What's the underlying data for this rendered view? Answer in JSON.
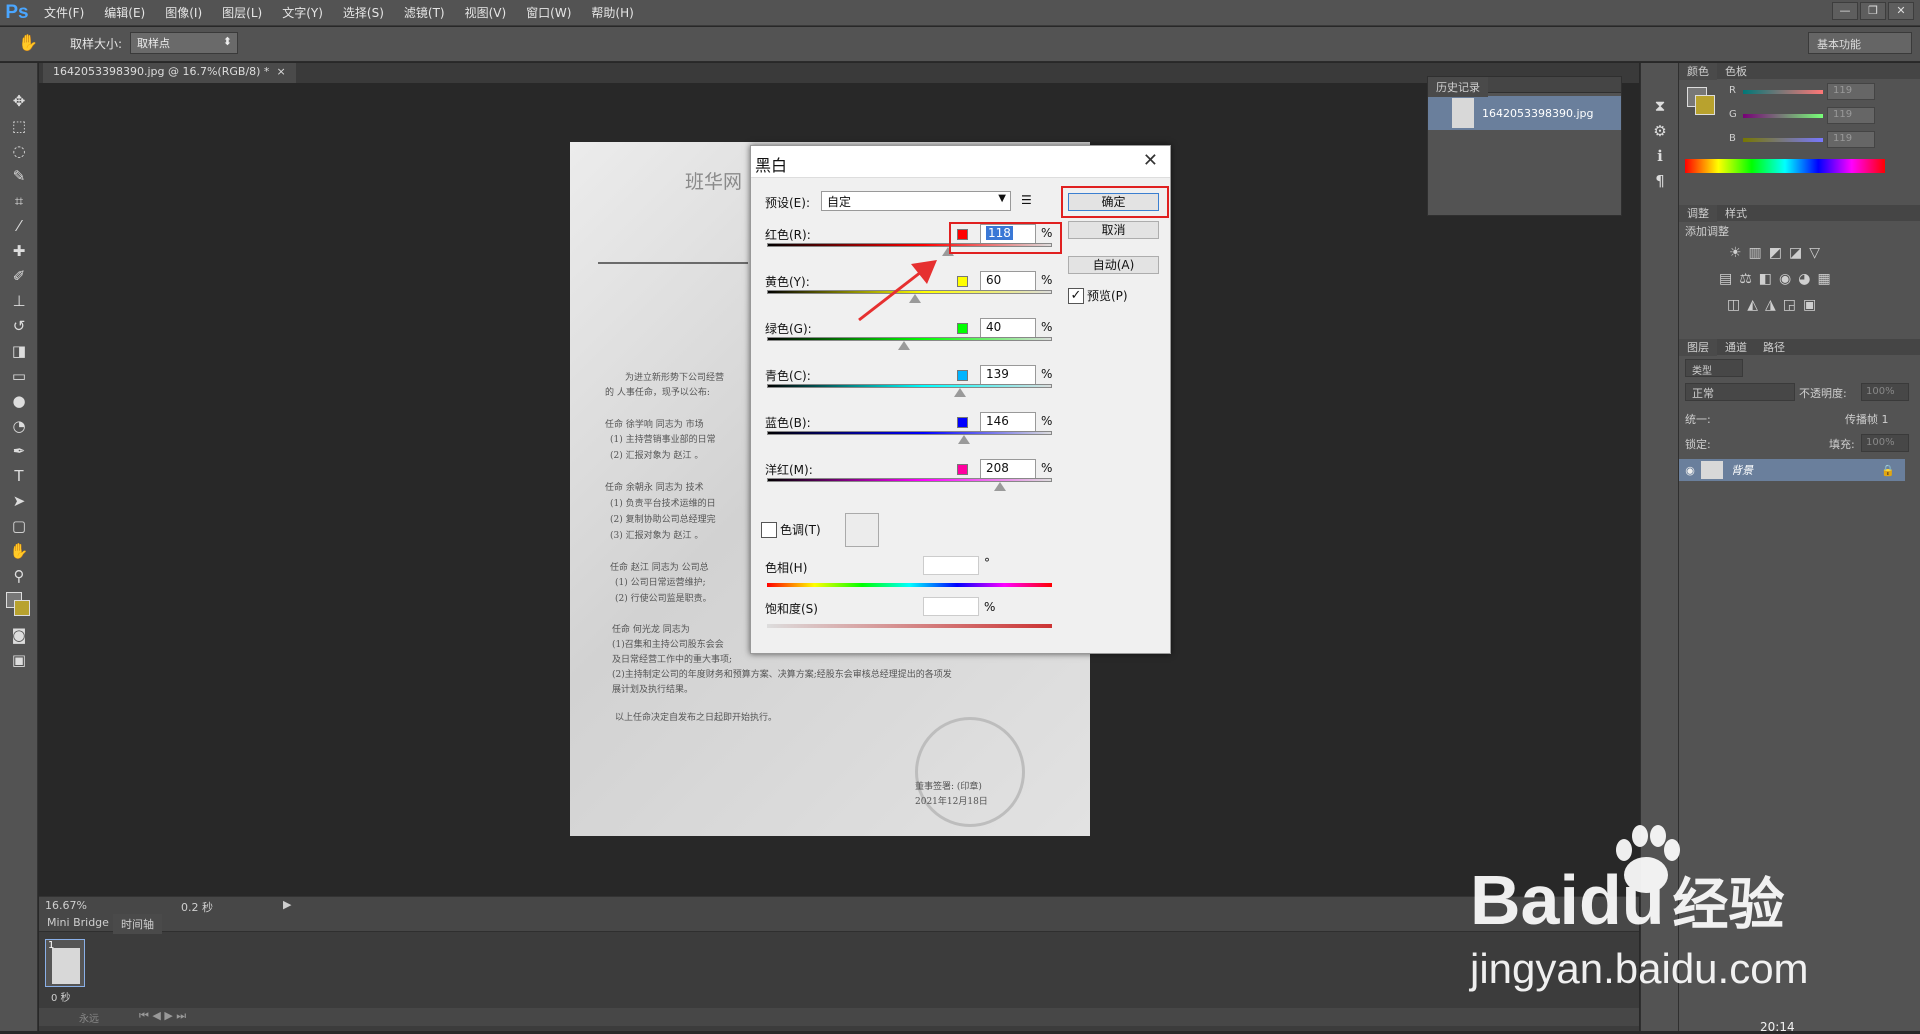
{
  "app": {
    "logo": "Ps",
    "menu": [
      "文件(F)",
      "编辑(E)",
      "图像(I)",
      "图层(L)",
      "文字(Y)",
      "选择(S)",
      "滤镜(T)",
      "视图(V)",
      "窗口(W)",
      "帮助(H)"
    ],
    "win_min": "—",
    "win_max": "❐",
    "win_close": "✕"
  },
  "options": {
    "sample_label": "取样大小:",
    "sample_value": "取样点",
    "workspace": "基本功能"
  },
  "document": {
    "tab_label": "1642053398390.jpg @ 16.7%(RGB/8) *",
    "tab_close": "×",
    "heading": "班华网",
    "lines": [
      "为进立新形势下公司经营",
      "的 人事任命，现予以公布:",
      "任命  徐学响  同志为  市场",
      "(1)  主持营销事业部的日常",
      "(2)  汇报对象为  赵江  。",
      "任命  余朝永  同志为  技术",
      "(1)  负责平台技术运维的日",
      "(2)  复制协助公司总经理完",
      "(3)  汇报对象为  赵江  。",
      "任命  赵江  同志为  公司总",
      "(1)  公司日常运营维护;",
      "(2)  行使公司监是职责。",
      "任命  何光龙  同志为",
      "(1)召集和主持公司股东会会",
      "及日常经营工作中的重大事项;",
      "(2)主持制定公司的年度财务和预算方案、决算方案;经股东会审核总经理提出的各项发",
      "展计划及执行结果。",
      "以上任命决定自发布之日起即开始执行。",
      "董事签署:   (印章)",
      "2021年12月18日"
    ]
  },
  "status": {
    "zoom": "16.67%",
    "time": "0.2 秒",
    "tab_bridge": "Mini Bridge",
    "tab_timeline": "时间轴",
    "frame_num": "1",
    "frame_time": "0 秒",
    "loop": "永远"
  },
  "history": {
    "title": "历史记录",
    "item": "1642053398390.jpg"
  },
  "color_panel": {
    "tab_color": "颜色",
    "tab_swatches": "色板",
    "channels": [
      {
        "name": "R",
        "value": "119"
      },
      {
        "name": "G",
        "value": "119"
      },
      {
        "name": "B",
        "value": "119"
      }
    ]
  },
  "adjust_panel": {
    "tab_adjust": "调整",
    "tab_style": "样式",
    "add_label": "添加调整"
  },
  "layers_panel": {
    "tab_layers": "图层",
    "tab_channels": "通道",
    "tab_paths": "路径",
    "filter_kind": "类型",
    "blend_mode": "正常",
    "opacity_label": "不透明度:",
    "opacity_value": "100%",
    "unify_label": "统一:",
    "propagate_label": "传播帧 1",
    "lock_label": "锁定:",
    "fill_label": "填充:",
    "fill_value": "100%",
    "layer_name": "背景"
  },
  "dialog": {
    "title": "黑白",
    "close": "✕",
    "preset_label": "预设(E):",
    "preset_value": "自定",
    "ok": "确定",
    "cancel": "取消",
    "auto": "自动(A)",
    "preview": "预览(P)",
    "preview_checked": true,
    "percent": "%",
    "channels": [
      {
        "label": "红色(R):",
        "value": "118",
        "color": "#ff0000",
        "percent": 118
      },
      {
        "label": "黄色(Y):",
        "value": "60",
        "color": "#ffff00",
        "percent": 60
      },
      {
        "label": "绿色(G):",
        "value": "40",
        "color": "#00ff00",
        "percent": 40
      },
      {
        "label": "青色(C):",
        "value": "139",
        "color": "#00b4ff",
        "percent": 139
      },
      {
        "label": "蓝色(B):",
        "value": "146",
        "color": "#0000ff",
        "percent": 146
      },
      {
        "label": "洋红(M):",
        "value": "208",
        "color": "#ff00a0",
        "percent": 208
      }
    ],
    "tint_label": "色调(T)",
    "hue_label": "色相(H)",
    "hue_unit": "°",
    "sat_label": "饱和度(S)",
    "sat_unit": "%"
  },
  "watermark": {
    "brand_a": "Bai",
    "brand_b": "du",
    "brand_cn": "经验",
    "url": "jingyan.baidu.com",
    "time": "20:14"
  }
}
